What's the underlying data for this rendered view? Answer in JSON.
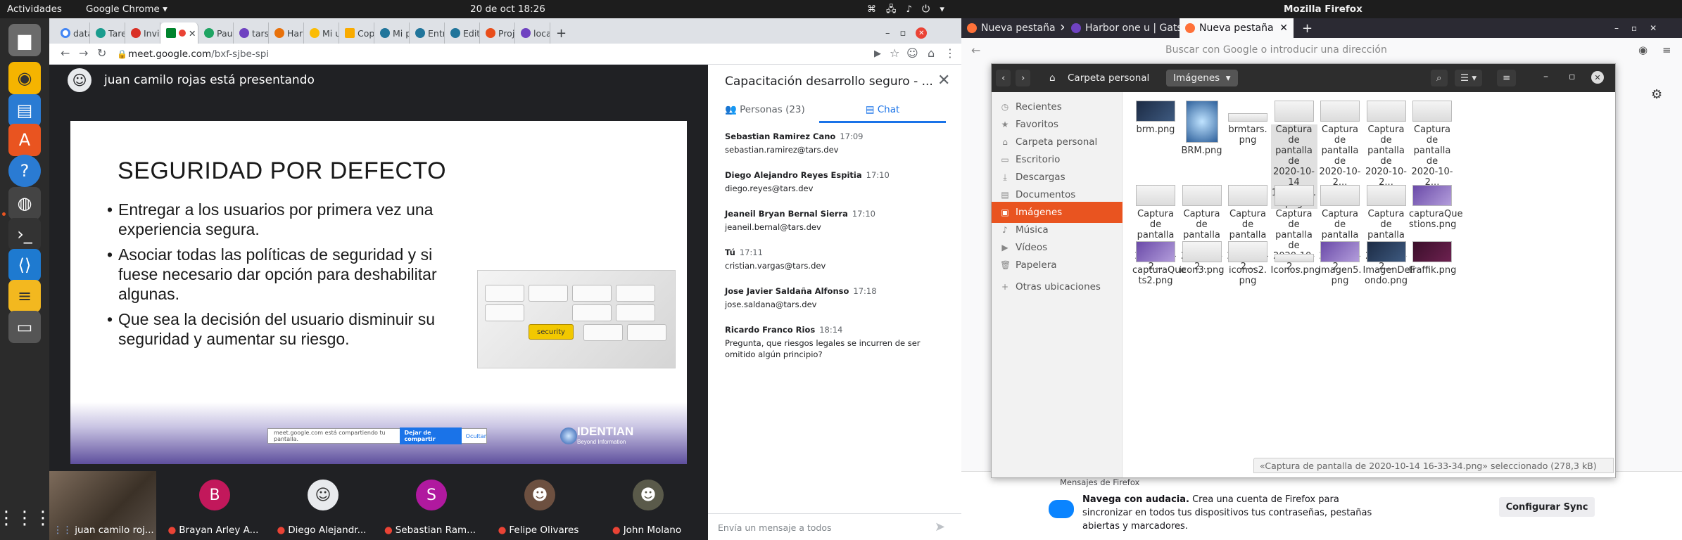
{
  "topbar": {
    "activities": "Actividades",
    "app_menu": "Google Chrome ▾",
    "clock": "20 de oct  18:26",
    "firefox_title": "Mozilla Firefox"
  },
  "chrome": {
    "tabs": [
      "datat",
      "Tarea",
      "Invita",
      "",
      "Paula",
      "tars.c",
      "Harbo",
      "Mi un",
      "Copia",
      "Mi pá",
      "Entra",
      "Edita",
      "Proje",
      "locali"
    ],
    "url_host": "meet.google.com",
    "url_path": "/bxf-sjbe-spi"
  },
  "meet": {
    "presenter_text": "juan camilo rojas está presentando",
    "slide": {
      "title": "SEGURIDAD POR DEFECTO",
      "bullets": [
        "Entregar a los usuarios por primera vez una experiencia segura.",
        "Asociar todas las políticas de seguridad y si fuese necesario dar opción para deshabilitar algunas.",
        "Que sea la decisión del usuario disminuir su seguridad y aumentar su riesgo."
      ],
      "key_label": "security",
      "share_text": "meet.google.com está compartiendo tu pantalla.",
      "share_stop": "Dejar de compartir",
      "share_hide": "Ocultar",
      "logo": "IDENTIAN",
      "logo_sub": "Beyond Information"
    },
    "participants": [
      {
        "name": "juan camilo roj...",
        "initial": "",
        "color": ""
      },
      {
        "name": "Brayan Arley A...",
        "initial": "B",
        "color": "#c2185b"
      },
      {
        "name": "Diego Alejandr...",
        "initial": "",
        "color": "#e8eaed"
      },
      {
        "name": "Sebastian Ram...",
        "initial": "S",
        "color": "#b0199f"
      },
      {
        "name": "Felipe Olivares",
        "initial": "",
        "color": "#3c4043"
      },
      {
        "name": "John Molano",
        "initial": "",
        "color": "#3c4043"
      }
    ]
  },
  "chat": {
    "title": "Capacitación desarrollo seguro - ...",
    "people_tab": "Personas (23)",
    "chat_tab": "Chat",
    "messages": [
      {
        "sender": "Sebastian Ramirez Cano",
        "time": "17:09",
        "text": "sebastian.ramirez@tars.dev"
      },
      {
        "sender": "Diego Alejandro Reyes Espitia",
        "time": "17:10",
        "text": "diego.reyes@tars.dev"
      },
      {
        "sender": "Jeaneil Bryan Bernal Sierra",
        "time": "17:10",
        "text": "jeaneil.bernal@tars.dev"
      },
      {
        "sender": "Tú",
        "time": "17:11",
        "text": "cristian.vargas@tars.dev"
      },
      {
        "sender": "Jose Javier Saldaña Alfonso",
        "time": "17:18",
        "text": "jose.saldana@tars.dev"
      },
      {
        "sender": "Ricardo Franco Rios",
        "time": "18:14",
        "text": "Pregunta, que riesgos legales se incurren de ser omitido algún principio?"
      }
    ],
    "input_placeholder": "Envía un mensaje a todos"
  },
  "firefox": {
    "tabs": [
      "Nueva pestaña",
      "Harbor one u | Gatsby De",
      "Nueva pestaña"
    ],
    "search_placeholder": "Buscar con Google o introducir una dirección",
    "messages_label": "Mensajes de Firefox",
    "msg_bold": "Navega con audacia.",
    "msg_text": " Crea una cuenta de Firefox para sincronizar en todos tus dispositivos tus contraseñas, pestañas abiertas y marcadores.",
    "sync_button": "Configurar Sync"
  },
  "nautilus": {
    "path": [
      "Carpeta personal",
      "Imágenes"
    ],
    "sidebar": [
      {
        "label": "Recientes",
        "icon": "clock-icon",
        "glyph": "◷"
      },
      {
        "label": "Favoritos",
        "icon": "star-icon",
        "glyph": "★"
      },
      {
        "label": "Carpeta personal",
        "icon": "home-icon",
        "glyph": "⌂"
      },
      {
        "label": "Escritorio",
        "icon": "desktop-icon",
        "glyph": "▭"
      },
      {
        "label": "Descargas",
        "icon": "download-icon",
        "glyph": "⤓"
      },
      {
        "label": "Documentos",
        "icon": "document-icon",
        "glyph": "▤"
      },
      {
        "label": "Imágenes",
        "icon": "image-icon",
        "glyph": "▣"
      },
      {
        "label": "Música",
        "icon": "music-icon",
        "glyph": "♪"
      },
      {
        "label": "Vídeos",
        "icon": "video-icon",
        "glyph": "▶"
      },
      {
        "label": "Papelera",
        "icon": "trash-icon",
        "glyph": "🗑"
      },
      {
        "label": "Otras ubicaciones",
        "icon": "plus-icon",
        "glyph": "+"
      }
    ],
    "files": [
      {
        "name": "brm.png",
        "kind": "dark"
      },
      {
        "name": "BRM.png",
        "kind": "tall"
      },
      {
        "name": "brmtars.\npng",
        "kind": "flat"
      },
      {
        "name": "Captura de\npantalla de\n2020-10-14\n16-33-34.\npng",
        "kind": "light"
      },
      {
        "name": "Captura de\npantalla de\n2020-10-2...",
        "kind": "light"
      },
      {
        "name": "Captura de\npantalla de\n2020-10-2...",
        "kind": "light"
      },
      {
        "name": "Captura de\npantalla de\n2020-10-2...",
        "kind": "light"
      },
      {
        "name": "Captura de\npantalla de\n2020-10-2...",
        "kind": "light"
      },
      {
        "name": "Captura de\npantalla de\n2020-10-2...",
        "kind": "light"
      },
      {
        "name": "Captura de\npantalla de\n2020-10-2...",
        "kind": "light"
      },
      {
        "name": "Captura de\npantalla de\n2020-10-2...",
        "kind": "light"
      },
      {
        "name": "Captura de\npantalla de\n2020-10-2...",
        "kind": "light"
      },
      {
        "name": "Captura de\npantalla de\n2020-10-2...",
        "kind": "light"
      },
      {
        "name": "capturaQue\nstions.png",
        "kind": "purple"
      },
      {
        "name": "capturaQue\nts2.png",
        "kind": "purple"
      },
      {
        "name": "icon3.png",
        "kind": "light"
      },
      {
        "name": "iconos2.\npng",
        "kind": "light"
      },
      {
        "name": "Iconos.png",
        "kind": "flat"
      },
      {
        "name": "imagen5.\npng",
        "kind": "purple"
      },
      {
        "name": "ImagenDeF\nondo.png",
        "kind": "dark"
      },
      {
        "name": "traffik.png",
        "kind": "wine"
      }
    ],
    "status": "«Captura de pantalla de 2020-10-14 16-33-34.png» seleccionado  (278,3 kB)"
  }
}
